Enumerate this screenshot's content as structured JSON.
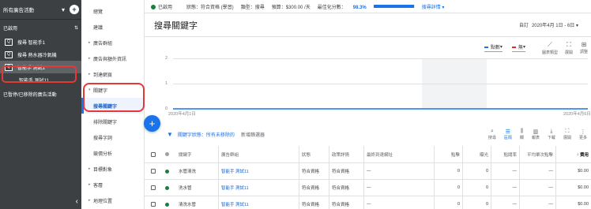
{
  "left_panel": {
    "title": "所有廣告活動",
    "section_label": "已啟用",
    "items": [
      {
        "label": "搜尋 智能手1",
        "icon": "search-campaign-icon",
        "sub": false,
        "selected": false
      },
      {
        "label": "搜尋 熱水器冷氣機",
        "icon": "search-campaign-icon",
        "sub": false,
        "selected": false
      },
      {
        "label": "智能手 測試1",
        "icon": "search-campaign-icon",
        "sub": false,
        "selected": true
      },
      {
        "label": "智能手 測試11",
        "icon": "",
        "sub": true,
        "selected": false
      }
    ],
    "footer": "已暫停/已移除的廣告活動"
  },
  "nav": {
    "items": [
      {
        "label": "總覽",
        "caret": false,
        "selected": false
      },
      {
        "label": "建議",
        "caret": false,
        "selected": false
      },
      {
        "label": "廣告群組",
        "caret": true,
        "selected": false
      },
      {
        "label": "廣告與額外資訊",
        "caret": true,
        "selected": false
      },
      {
        "label": "到達網頁",
        "caret": true,
        "selected": false
      },
      {
        "label": "關鍵字",
        "caret": true,
        "selected": false
      },
      {
        "label": "搜尋關鍵字",
        "caret": false,
        "selected": true
      },
      {
        "label": "排除關鍵字",
        "caret": false,
        "selected": false
      },
      {
        "label": "搜尋字詞",
        "caret": false,
        "selected": false
      },
      {
        "label": "競價分析",
        "caret": false,
        "selected": false
      },
      {
        "label": "目標對象",
        "caret": true,
        "selected": false
      },
      {
        "label": "客層",
        "caret": true,
        "selected": false
      },
      {
        "label": "地理位置",
        "caret": true,
        "selected": false
      }
    ]
  },
  "status_bar": {
    "status": "已啟用",
    "state": "狀態：符合資格 (學習)",
    "type": "類型：搜尋",
    "budget": "預算：$300.00 /天",
    "score_label": "最佳化分數：",
    "score_value": "98.3%",
    "score_fraction": 0.983,
    "details": "搜尋詳情 ▾"
  },
  "header": {
    "title": "搜尋關鍵字",
    "date_label": "自訂",
    "date_range": "2020年4月 1日 - 6日"
  },
  "chart": {
    "metric1": "點數",
    "metric1_color": "#1a73e8",
    "metric2": "無",
    "metric2_color": "#d93025",
    "buttons": [
      {
        "icon": "chart-type-icon",
        "label": "圖表類型"
      },
      {
        "icon": "expand-icon",
        "label": "展開"
      },
      {
        "icon": "adjust-icon",
        "label": "調整"
      }
    ]
  },
  "chart_data": {
    "type": "line",
    "x_start": "2020年4月1日",
    "x_end": "2020年4月6日",
    "y_ticks": [
      "2",
      "1",
      "0"
    ],
    "ylim": [
      0,
      2
    ],
    "series": [
      {
        "values": [
          0,
          0,
          0,
          0,
          0,
          0
        ]
      }
    ]
  },
  "table_toolbar": {
    "filter_text": "關鍵字狀態：所有未移除的",
    "add_filter": "新增篩選器",
    "buttons": [
      {
        "icon": "search-icon",
        "label": "搜尋"
      },
      {
        "icon": "segment-icon",
        "label": "區隔"
      },
      {
        "icon": "columns-icon",
        "label": "欄"
      },
      {
        "icon": "report-icon",
        "label": "報表"
      },
      {
        "icon": "download-icon",
        "label": "下載"
      },
      {
        "icon": "expand-icon",
        "label": "展開"
      },
      {
        "icon": "more-icon",
        "label": "更多"
      }
    ]
  },
  "table": {
    "headers": [
      "關鍵字",
      "廣告群組",
      "狀態",
      "政策詳情",
      "最終到達網址",
      "點擊",
      "曝光",
      "點閱率",
      "平均單次點擊",
      "費用"
    ],
    "rows": [
      [
        "水管清洗",
        "智能手 測試11",
        "符合資格",
        "符合資格",
        "—",
        "0",
        "0",
        "—",
        "—",
        "$0.00"
      ],
      [
        "洗水管",
        "智能手 測試11",
        "符合資格",
        "符合資格",
        "—",
        "0",
        "0",
        "—",
        "—",
        "$0.00"
      ],
      [
        "清洗水管",
        "智能手 測試11",
        "符合資格",
        "符合資格",
        "—",
        "0",
        "0",
        "—",
        "—",
        "$0.00"
      ]
    ]
  }
}
